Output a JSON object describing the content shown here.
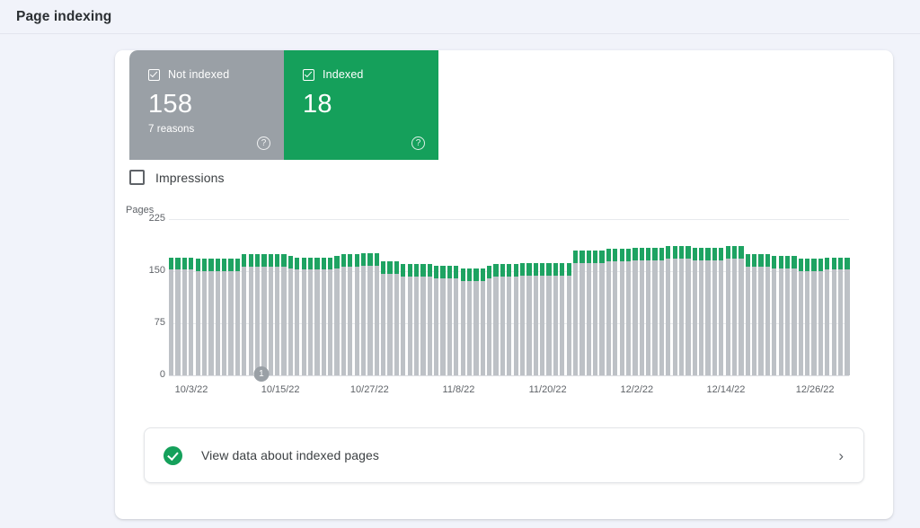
{
  "header": {
    "title": "Page indexing"
  },
  "status_tiles": [
    {
      "id": "not-indexed",
      "label": "Not indexed",
      "count": "158",
      "sublabel": "7 reasons",
      "color": "#9aa0a6",
      "checked": true,
      "help_glyph": "?"
    },
    {
      "id": "indexed",
      "label": "Indexed",
      "count": "18",
      "sublabel": "",
      "color": "#15a05b",
      "checked": true,
      "help_glyph": "?"
    }
  ],
  "legend": {
    "impressions_label": "Impressions",
    "impressions_checked": false
  },
  "link_card": {
    "text": "View data about indexed pages",
    "chevron_glyph": "›",
    "icon": "check-circle-icon"
  },
  "annotation": {
    "marker_label": "1",
    "x_percent": 13.6
  },
  "chart_data": {
    "type": "bar",
    "stacked": true,
    "title": "",
    "xlabel": "",
    "ylabel": "Pages",
    "ylim": [
      0,
      225
    ],
    "yticks": [
      "225",
      "150",
      "75",
      "0"
    ],
    "ytick_values": [
      225,
      150,
      75,
      0
    ],
    "grid": true,
    "legend_position": "top-left",
    "tick_labels": [
      "10/3/22",
      "10/15/22",
      "10/27/22",
      "11/8/22",
      "11/20/22",
      "12/2/22",
      "12/14/22",
      "12/26/22"
    ],
    "tick_positions_percent": [
      3.3,
      16.4,
      29.5,
      42.6,
      55.7,
      68.8,
      81.9,
      95.0
    ],
    "series": [
      {
        "name": "Not indexed",
        "color": "#bdc1c6",
        "values": [
          152,
          152,
          152,
          152,
          150,
          150,
          150,
          150,
          150,
          150,
          150,
          156,
          156,
          156,
          156,
          156,
          156,
          156,
          154,
          152,
          152,
          152,
          152,
          152,
          152,
          154,
          156,
          156,
          156,
          158,
          158,
          158,
          146,
          146,
          146,
          142,
          142,
          142,
          142,
          142,
          140,
          140,
          140,
          140,
          136,
          136,
          136,
          136,
          140,
          142,
          142,
          142,
          142,
          144,
          144,
          144,
          144,
          144,
          144,
          144,
          144,
          162,
          162,
          162,
          162,
          162,
          164,
          164,
          164,
          164,
          166,
          166,
          166,
          166,
          166,
          168,
          168,
          168,
          168,
          166,
          166,
          166,
          166,
          166,
          168,
          168,
          168,
          156,
          156,
          156,
          156,
          154,
          154,
          154,
          154,
          150,
          150,
          150,
          150,
          152,
          152,
          152,
          152
        ]
      },
      {
        "name": "Indexed",
        "color": "#1ea362",
        "values": [
          18,
          18,
          18,
          18,
          18,
          18,
          18,
          18,
          18,
          18,
          18,
          18,
          18,
          18,
          18,
          18,
          18,
          18,
          18,
          18,
          18,
          18,
          18,
          18,
          18,
          18,
          18,
          18,
          18,
          18,
          18,
          18,
          18,
          18,
          18,
          18,
          18,
          18,
          18,
          18,
          18,
          18,
          18,
          18,
          18,
          18,
          18,
          18,
          18,
          18,
          18,
          18,
          18,
          18,
          18,
          18,
          18,
          18,
          18,
          18,
          18,
          18,
          18,
          18,
          18,
          18,
          18,
          18,
          18,
          18,
          18,
          18,
          18,
          18,
          18,
          18,
          18,
          18,
          18,
          18,
          18,
          18,
          18,
          18,
          18,
          18,
          18,
          18,
          18,
          18,
          18,
          18,
          18,
          18,
          18,
          18,
          18,
          18,
          18,
          18,
          18,
          18,
          18
        ]
      }
    ]
  }
}
